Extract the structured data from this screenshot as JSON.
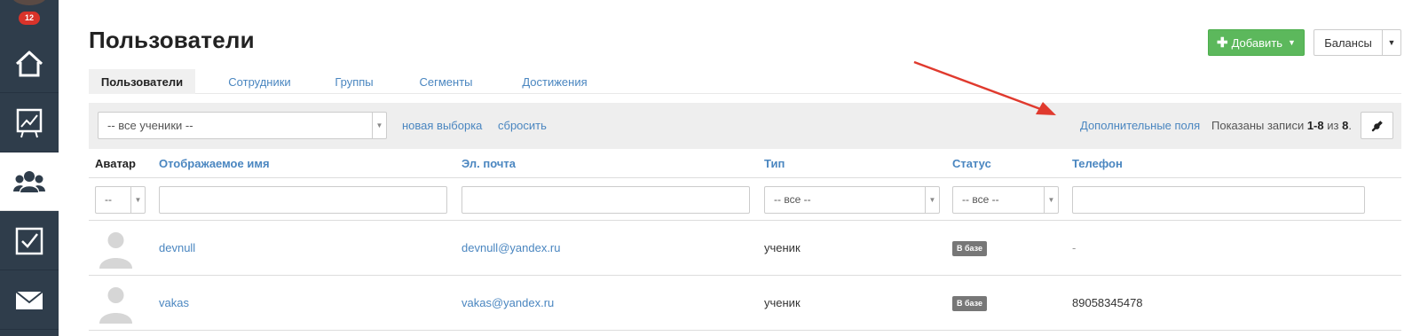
{
  "sidebar": {
    "notification_count": "12",
    "items": [
      {
        "icon": "home-icon",
        "active": false
      },
      {
        "icon": "chart-icon",
        "active": false
      },
      {
        "icon": "users-icon",
        "active": true
      },
      {
        "icon": "checkbox-icon",
        "active": false
      },
      {
        "icon": "mail-icon",
        "active": false
      }
    ]
  },
  "header": {
    "title": "Пользователи",
    "add_button_label": "Добавить",
    "balances_button_label": "Балансы"
  },
  "tabs": [
    {
      "label": "Пользователи",
      "active": true
    },
    {
      "label": "Сотрудники",
      "active": false
    },
    {
      "label": "Группы",
      "active": false
    },
    {
      "label": "Сегменты",
      "active": false
    },
    {
      "label": "Достижения",
      "active": false
    }
  ],
  "filter_bar": {
    "learners_select_value": "-- все ученики --",
    "new_selection_link": "новая выборка",
    "reset_link": "сбросить",
    "extra_fields_link": "Дополнительные поля",
    "records_prefix": "Показаны записи ",
    "records_range": "1-8",
    "records_of": " из ",
    "records_total": "8",
    "records_suffix": "."
  },
  "table": {
    "columns": [
      "Аватар",
      "Отображаемое имя",
      "Эл. почта",
      "Тип",
      "Статус",
      "Телефон"
    ],
    "filters": {
      "avatar_select": "--",
      "type_select": "-- все --",
      "status_select": "-- все --"
    },
    "rows": [
      {
        "name": "devnull",
        "email": "devnull@yandex.ru",
        "type": "ученик",
        "status": "В базе",
        "phone": "-"
      },
      {
        "name": "vakas",
        "email": "vakas@yandex.ru",
        "type": "ученик",
        "status": "В базе",
        "phone": "89058345478"
      }
    ]
  },
  "colors": {
    "sidebar_bg": "#2f3d4b",
    "link": "#4a86c0",
    "add_button": "#5cb85c",
    "badge": "#d9332a",
    "annotation_arrow": "#e03a2e"
  }
}
